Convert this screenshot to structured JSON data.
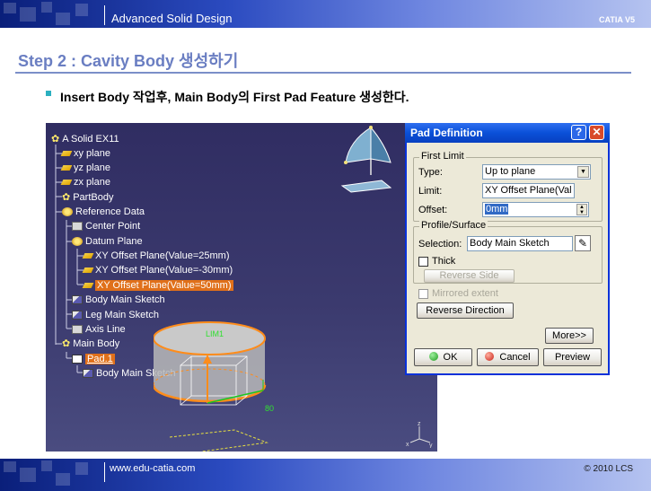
{
  "header": {
    "title": "Advanced Solid Design",
    "brand": "CATIA V5"
  },
  "heading": "Step 2 : Cavity Body 생성하기",
  "bullet": "Insert Body 작업후, Main Body의 First Pad Feature 생성한다.",
  "tree": {
    "items": [
      {
        "label": "A Solid EX11",
        "icon": "part-gear-icon"
      },
      {
        "label": "xy plane",
        "icon": "plane-icon"
      },
      {
        "label": "yz plane",
        "icon": "plane-icon"
      },
      {
        "label": "zx plane",
        "icon": "plane-icon"
      },
      {
        "label": "PartBody",
        "icon": "body-gear-icon"
      },
      {
        "label": "Reference Data",
        "icon": "reference-icon"
      },
      {
        "label": "Center Point",
        "icon": "point-icon"
      },
      {
        "label": "Datum Plane",
        "icon": "reference-icon"
      },
      {
        "label": "XY Offset Plane(Value=25mm)",
        "icon": "plane-icon"
      },
      {
        "label": "XY Offset Plane(Value=-30mm)",
        "icon": "plane-icon"
      },
      {
        "label": "XY Offset Plane(Value=50mm)",
        "icon": "plane-icon"
      },
      {
        "label": "Body Main Sketch",
        "icon": "sketch-icon"
      },
      {
        "label": "Leg Main Sketch",
        "icon": "sketch-icon"
      },
      {
        "label": "Axis Line",
        "icon": "axis-icon"
      },
      {
        "label": "Main Body",
        "icon": "body-gear-icon"
      },
      {
        "label": "Pad.1",
        "icon": "pad-icon"
      },
      {
        "label": "Body Main Sketch",
        "icon": "sketch-icon"
      }
    ]
  },
  "viewport": {
    "lim_label": "LIM1",
    "dim_label": "80"
  },
  "dialog": {
    "title": "Pad Definition",
    "help": "?",
    "close": "✕",
    "first_limit": {
      "label": "First Limit",
      "type_label": "Type:",
      "type_value": "Up to plane",
      "limit_label": "Limit:",
      "limit_value": "XY Offset Plane(Val",
      "offset_label": "Offset:",
      "offset_value": "0mm"
    },
    "profile": {
      "label": "Profile/Surface",
      "selection_label": "Selection:",
      "selection_value": "Body Main Sketch",
      "thick_label": "Thick",
      "reverse_side": "Reverse Side"
    },
    "mirrored_extent": "Mirrored extent",
    "reverse_direction": "Reverse Direction",
    "more": "More>>",
    "ok": "OK",
    "cancel": "Cancel",
    "preview": "Preview"
  },
  "footer": {
    "url": "www.edu-catia.com",
    "copyright": "© 2010 LCS"
  },
  "colors": {
    "heading": "#6a7ec2",
    "highlight": "#e0701a",
    "viewport": "#35346a",
    "dialog_title": "#0a50d8"
  }
}
